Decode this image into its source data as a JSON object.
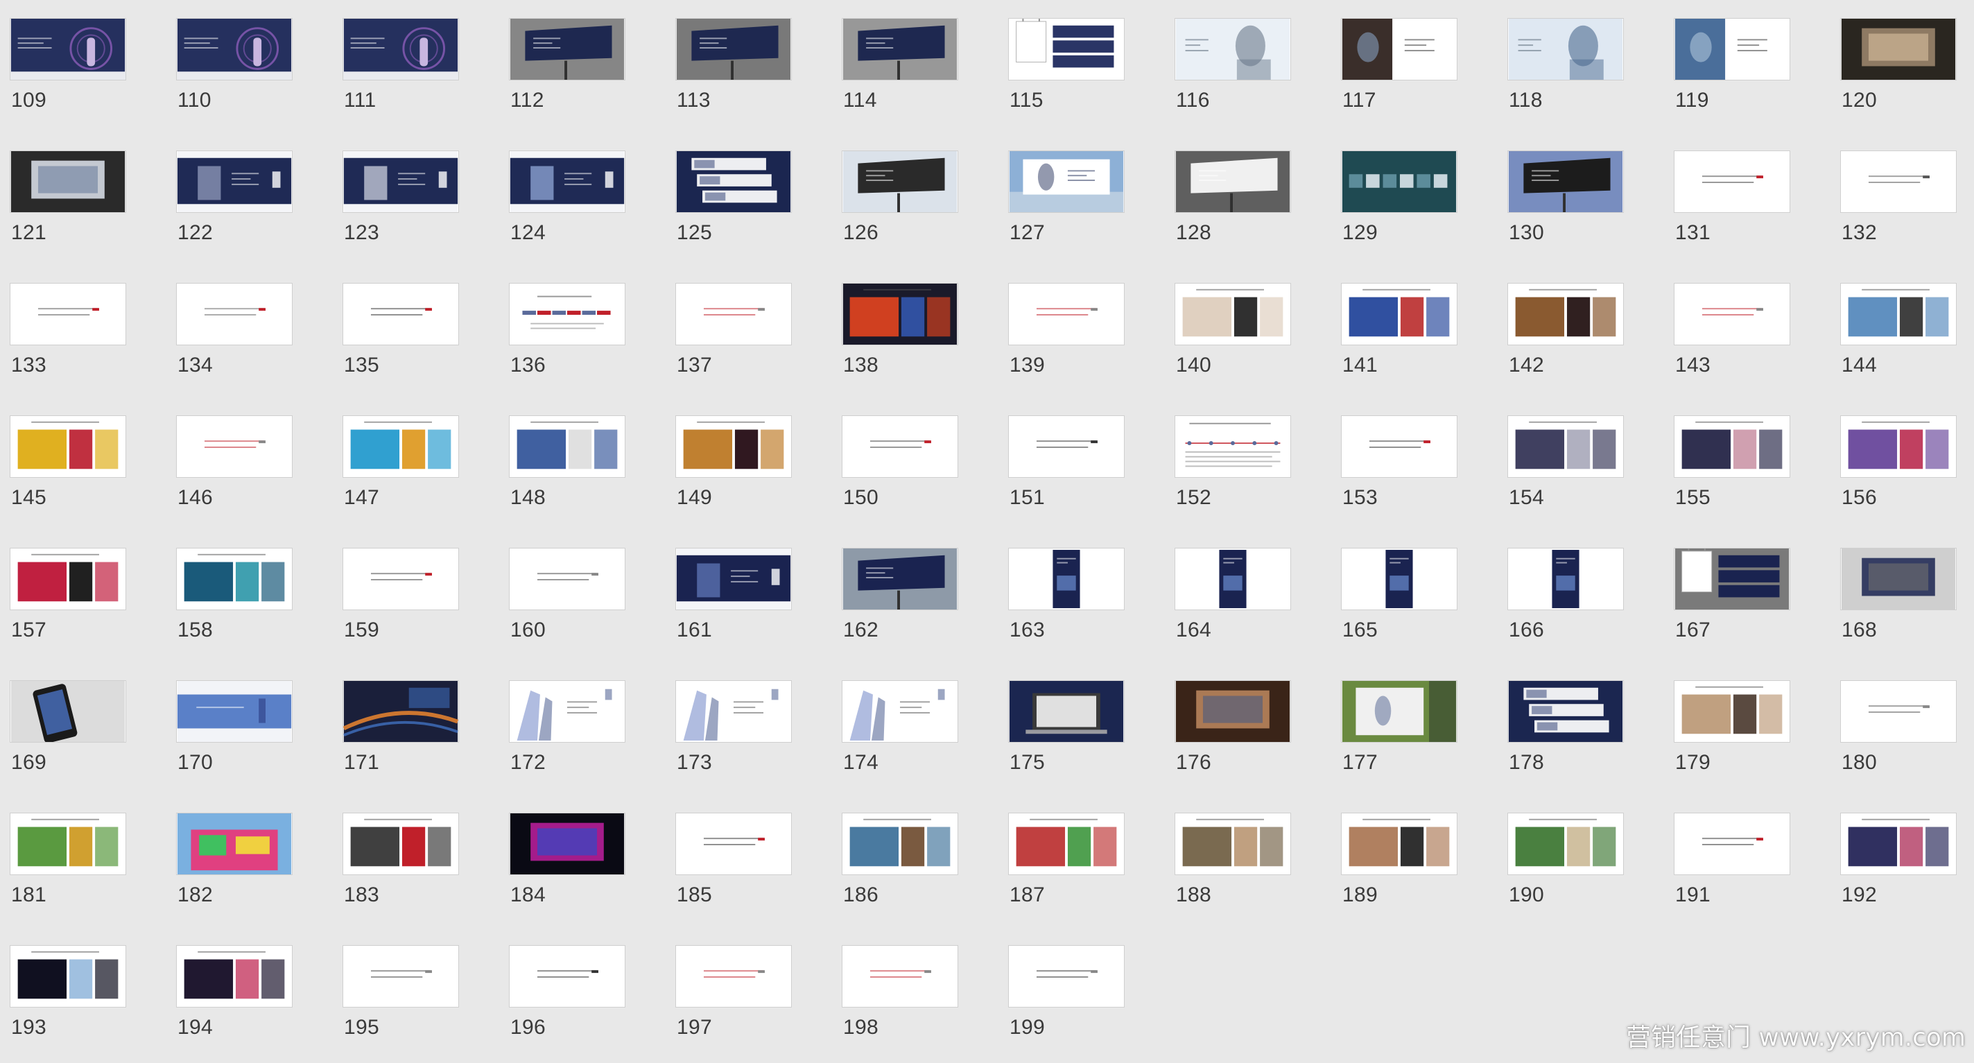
{
  "view": {
    "type": "slide-sorter",
    "columns": 12,
    "rows": 9
  },
  "slides": [
    {
      "number": "109",
      "style": "dark-poster",
      "colors": [
        "#25305e",
        "#8b5cb8",
        "#ffffff"
      ]
    },
    {
      "number": "110",
      "style": "dark-poster",
      "colors": [
        "#25305e",
        "#8b5cb8",
        "#ffffff"
      ]
    },
    {
      "number": "111",
      "style": "dark-poster",
      "colors": [
        "#25305e",
        "#8b5cb8",
        "#ffffff"
      ]
    },
    {
      "number": "112",
      "style": "billboard-photo",
      "colors": [
        "#5a5a5a",
        "#1e2850",
        "#d8d8d8"
      ]
    },
    {
      "number": "113",
      "style": "billboard-photo",
      "colors": [
        "#3c3c3c",
        "#1e2850",
        "#ececec"
      ]
    },
    {
      "number": "114",
      "style": "billboard-photo",
      "colors": [
        "#7a7a7a",
        "#1e2850",
        "#d0d0d0"
      ]
    },
    {
      "number": "115",
      "style": "bag-mockup",
      "colors": [
        "#ffffff",
        "#2a3566",
        "#999999"
      ]
    },
    {
      "number": "116",
      "style": "portrait-light",
      "colors": [
        "#eaf0f6",
        "#6a7a8c",
        "#ffffff"
      ]
    },
    {
      "number": "117",
      "style": "split-photo",
      "colors": [
        "#3a2e2a",
        "#ffffff",
        "#7a8ea8"
      ]
    },
    {
      "number": "118",
      "style": "portrait-light",
      "colors": [
        "#dfe8f2",
        "#4c6a90",
        "#ffffff"
      ]
    },
    {
      "number": "119",
      "style": "split-photo",
      "colors": [
        "#4a6e9a",
        "#ffffff",
        "#a0b8d0"
      ]
    },
    {
      "number": "120",
      "style": "dark-photo",
      "colors": [
        "#2a2620",
        "#a08a70",
        "#d8c0a0"
      ]
    },
    {
      "number": "121",
      "style": "dark-photo",
      "colors": [
        "#2a2a2a",
        "#dfe5ef",
        "#6d7f9c"
      ]
    },
    {
      "number": "122",
      "style": "navy-banner",
      "colors": [
        "#1f2a55",
        "#ffffff",
        "#8b95b5"
      ]
    },
    {
      "number": "123",
      "style": "navy-banner",
      "colors": [
        "#1f2a55",
        "#ffffff",
        "#c2c7d6"
      ]
    },
    {
      "number": "124",
      "style": "navy-banner",
      "colors": [
        "#1f2a55",
        "#ffffff",
        "#8aa0d0"
      ]
    },
    {
      "number": "125",
      "style": "navy-panels",
      "colors": [
        "#1b2650",
        "#ffffff",
        "#8a93b0"
      ]
    },
    {
      "number": "126",
      "style": "billboard-photo",
      "colors": [
        "#c8d2de",
        "#2a2a2a",
        "#ffffff"
      ]
    },
    {
      "number": "127",
      "style": "sky-billboard",
      "colors": [
        "#8db0d6",
        "#ffffff",
        "#28345e"
      ]
    },
    {
      "number": "128",
      "style": "billboard-photo",
      "colors": [
        "#4a4a4a",
        "#f0f0f0",
        "#888888"
      ]
    },
    {
      "number": "129",
      "style": "teal-strip",
      "colors": [
        "#1f4a52",
        "#c8d6dc",
        "#5c8c9a"
      ]
    },
    {
      "number": "130",
      "style": "billboard-photo",
      "colors": [
        "#3a5aa8",
        "#1c1c1c",
        "#ececec"
      ]
    },
    {
      "number": "131",
      "style": "text-white",
      "colors": [
        "#ffffff",
        "#444444",
        "#c0202a"
      ]
    },
    {
      "number": "132",
      "style": "text-white",
      "colors": [
        "#ffffff",
        "#555555",
        "#555555"
      ]
    },
    {
      "number": "133",
      "style": "text-white",
      "colors": [
        "#ffffff",
        "#555555",
        "#c0202a"
      ]
    },
    {
      "number": "134",
      "style": "text-white",
      "colors": [
        "#ffffff",
        "#666666",
        "#c0202a"
      ]
    },
    {
      "number": "135",
      "style": "text-white",
      "colors": [
        "#ffffff",
        "#333333",
        "#c0202a"
      ]
    },
    {
      "number": "136",
      "style": "text-colorstrip",
      "colors": [
        "#ffffff",
        "#c0202a",
        "#5a6a9a"
      ]
    },
    {
      "number": "137",
      "style": "text-white",
      "colors": [
        "#ffffff",
        "#c0202a",
        "#888888"
      ]
    },
    {
      "number": "138",
      "style": "photo-grid",
      "colors": [
        "#1a1a2a",
        "#d04020",
        "#3050a0"
      ]
    },
    {
      "number": "139",
      "style": "text-white",
      "colors": [
        "#ffffff",
        "#c0202a",
        "#888888"
      ]
    },
    {
      "number": "140",
      "style": "photo-grid",
      "colors": [
        "#ffffff",
        "#e0d0c0",
        "#303030"
      ]
    },
    {
      "number": "141",
      "style": "photo-grid",
      "colors": [
        "#ffffff",
        "#3050a0",
        "#c04040"
      ]
    },
    {
      "number": "142",
      "style": "photo-grid",
      "colors": [
        "#ffffff",
        "#8a5a30",
        "#302020"
      ]
    },
    {
      "number": "143",
      "style": "text-white",
      "colors": [
        "#ffffff",
        "#c0202a",
        "#888888"
      ]
    },
    {
      "number": "144",
      "style": "photo-grid",
      "colors": [
        "#ffffff",
        "#6090c0",
        "#404040"
      ]
    },
    {
      "number": "145",
      "style": "photo-grid",
      "colors": [
        "#ffffff",
        "#e0b020",
        "#c03040"
      ]
    },
    {
      "number": "146",
      "style": "text-white",
      "colors": [
        "#ffffff",
        "#c0202a",
        "#888888"
      ]
    },
    {
      "number": "147",
      "style": "photo-grid",
      "colors": [
        "#ffffff",
        "#30a0d0",
        "#e0a030"
      ]
    },
    {
      "number": "148",
      "style": "photo-grid",
      "colors": [
        "#ffffff",
        "#4060a0",
        "#e0e0e0"
      ]
    },
    {
      "number": "149",
      "style": "photo-grid",
      "colors": [
        "#ffffff",
        "#c08030",
        "#301820"
      ]
    },
    {
      "number": "150",
      "style": "text-white",
      "colors": [
        "#ffffff",
        "#444444",
        "#c0202a"
      ]
    },
    {
      "number": "151",
      "style": "text-white",
      "colors": [
        "#ffffff",
        "#333333",
        "#333333"
      ]
    },
    {
      "number": "152",
      "style": "text-diagram",
      "colors": [
        "#ffffff",
        "#c0202a",
        "#5a6a9a"
      ]
    },
    {
      "number": "153",
      "style": "text-white",
      "colors": [
        "#ffffff",
        "#333333",
        "#c0202a"
      ]
    },
    {
      "number": "154",
      "style": "photo-grid",
      "colors": [
        "#ffffff",
        "#404060",
        "#b0b0c0"
      ]
    },
    {
      "number": "155",
      "style": "photo-grid",
      "colors": [
        "#ffffff",
        "#303050",
        "#d0a0b0"
      ]
    },
    {
      "number": "156",
      "style": "photo-grid",
      "colors": [
        "#ffffff",
        "#7050a0",
        "#c04060"
      ]
    },
    {
      "number": "157",
      "style": "photo-grid",
      "colors": [
        "#ffffff",
        "#c02040",
        "#202020"
      ]
    },
    {
      "number": "158",
      "style": "photo-grid",
      "colors": [
        "#ffffff",
        "#1a5a7a",
        "#40a0b0"
      ]
    },
    {
      "number": "159",
      "style": "text-white",
      "colors": [
        "#ffffff",
        "#444444",
        "#c0202a"
      ]
    },
    {
      "number": "160",
      "style": "text-white",
      "colors": [
        "#ffffff",
        "#444444",
        "#888888"
      ]
    },
    {
      "number": "161",
      "style": "navy-banner",
      "colors": [
        "#1a2350",
        "#ffffff",
        "#5a70b0"
      ]
    },
    {
      "number": "162",
      "style": "billboard-photo",
      "colors": [
        "#6a7a8a",
        "#1a2350",
        "#d0d8e0"
      ]
    },
    {
      "number": "163",
      "style": "vertical-banner",
      "colors": [
        "#ffffff",
        "#1a2350",
        "#6080c0"
      ]
    },
    {
      "number": "164",
      "style": "vertical-banner",
      "colors": [
        "#ffffff",
        "#1a2350",
        "#6080c0"
      ]
    },
    {
      "number": "165",
      "style": "vertical-banner",
      "colors": [
        "#ffffff",
        "#1a2350",
        "#6080c0"
      ]
    },
    {
      "number": "166",
      "style": "vertical-banner",
      "colors": [
        "#ffffff",
        "#1a2350",
        "#6080c0"
      ]
    },
    {
      "number": "167",
      "style": "bag-mockup",
      "colors": [
        "#7a7a7a",
        "#1a2350",
        "#ffffff"
      ]
    },
    {
      "number": "168",
      "style": "dark-photo",
      "colors": [
        "#cfcfcf",
        "#1a2350",
        "#707070"
      ]
    },
    {
      "number": "169",
      "style": "phone-photo",
      "colors": [
        "#dcdcdc",
        "#1a1a1a",
        "#4060a0"
      ]
    },
    {
      "number": "170",
      "style": "sky-banner",
      "colors": [
        "#5a80c8",
        "#ffffff",
        "#2a3a80"
      ]
    },
    {
      "number": "171",
      "style": "city-night",
      "colors": [
        "#1a1f3a",
        "#e08030",
        "#4070c0"
      ]
    },
    {
      "number": "172",
      "style": "arch-white",
      "colors": [
        "#ffffff",
        "#5a6a9a",
        "#b0bce0"
      ]
    },
    {
      "number": "173",
      "style": "arch-white",
      "colors": [
        "#ffffff",
        "#5a6a9a",
        "#b0bce0"
      ]
    },
    {
      "number": "174",
      "style": "arch-white",
      "colors": [
        "#ffffff",
        "#5a6a9a",
        "#b0bce0"
      ]
    },
    {
      "number": "175",
      "style": "navy-laptop",
      "colors": [
        "#1b2650",
        "#e0e0e0",
        "#3a3a3a"
      ]
    },
    {
      "number": "176",
      "style": "dark-photo",
      "colors": [
        "#3a2418",
        "#c08a60",
        "#4a5a80"
      ]
    },
    {
      "number": "177",
      "style": "outdoor-lightbox",
      "colors": [
        "#6a8a40",
        "#f0f0f0",
        "#3a4a30"
      ]
    },
    {
      "number": "178",
      "style": "navy-panels",
      "colors": [
        "#1b2650",
        "#ffffff",
        "#8a93b0"
      ]
    },
    {
      "number": "179",
      "style": "photo-grid",
      "colors": [
        "#ffffff",
        "#c0a080",
        "#5a4a40"
      ]
    },
    {
      "number": "180",
      "style": "text-white",
      "colors": [
        "#ffffff",
        "#555555",
        "#888888"
      ]
    },
    {
      "number": "181",
      "style": "photo-grid",
      "colors": [
        "#ffffff",
        "#5a9a40",
        "#d0a030"
      ]
    },
    {
      "number": "182",
      "style": "colorful-building",
      "colors": [
        "#7ab0e0",
        "#e04080",
        "#40c060"
      ]
    },
    {
      "number": "183",
      "style": "photo-grid",
      "colors": [
        "#ffffff",
        "#404040",
        "#c0202a"
      ]
    },
    {
      "number": "184",
      "style": "dark-photo",
      "colors": [
        "#0a0a14",
        "#c020a0",
        "#2050d0"
      ]
    },
    {
      "number": "185",
      "style": "text-white",
      "colors": [
        "#ffffff",
        "#333333",
        "#c0202a"
      ]
    },
    {
      "number": "186",
      "style": "photo-grid",
      "colors": [
        "#ffffff",
        "#4a7aa0",
        "#7a5a40"
      ]
    },
    {
      "number": "187",
      "style": "photo-grid",
      "colors": [
        "#ffffff",
        "#c04040",
        "#50a050"
      ]
    },
    {
      "number": "188",
      "style": "photo-grid",
      "colors": [
        "#ffffff",
        "#7a6a50",
        "#c0a080"
      ]
    },
    {
      "number": "189",
      "style": "photo-grid",
      "colors": [
        "#ffffff",
        "#b08060",
        "#303030"
      ]
    },
    {
      "number": "190",
      "style": "photo-grid",
      "colors": [
        "#ffffff",
        "#4a8040",
        "#d0c0a0"
      ]
    },
    {
      "number": "191",
      "style": "text-white",
      "colors": [
        "#ffffff",
        "#333333",
        "#c0202a"
      ]
    },
    {
      "number": "192",
      "style": "photo-grid",
      "colors": [
        "#ffffff",
        "#303060",
        "#c06080"
      ]
    },
    {
      "number": "193",
      "style": "photo-grid",
      "colors": [
        "#ffffff",
        "#101020",
        "#a0c0e0"
      ]
    },
    {
      "number": "194",
      "style": "photo-grid",
      "colors": [
        "#ffffff",
        "#201830",
        "#d06080"
      ]
    },
    {
      "number": "195",
      "style": "text-white",
      "colors": [
        "#ffffff",
        "#444444",
        "#888888"
      ]
    },
    {
      "number": "196",
      "style": "text-white",
      "colors": [
        "#ffffff",
        "#333333",
        "#333333"
      ]
    },
    {
      "number": "197",
      "style": "text-white",
      "colors": [
        "#ffffff",
        "#c0202a",
        "#888888"
      ]
    },
    {
      "number": "198",
      "style": "text-white",
      "colors": [
        "#ffffff",
        "#c0202a",
        "#888888"
      ]
    },
    {
      "number": "199",
      "style": "text-white",
      "colors": [
        "#ffffff",
        "#333333",
        "#888888"
      ]
    }
  ],
  "watermark": {
    "text": "营销任意门 www.yxrym.com"
  },
  "colors": {
    "background": "#e8e8e8",
    "number_text": "#3a3a3a",
    "thumb_border": "#cfcfcf"
  }
}
